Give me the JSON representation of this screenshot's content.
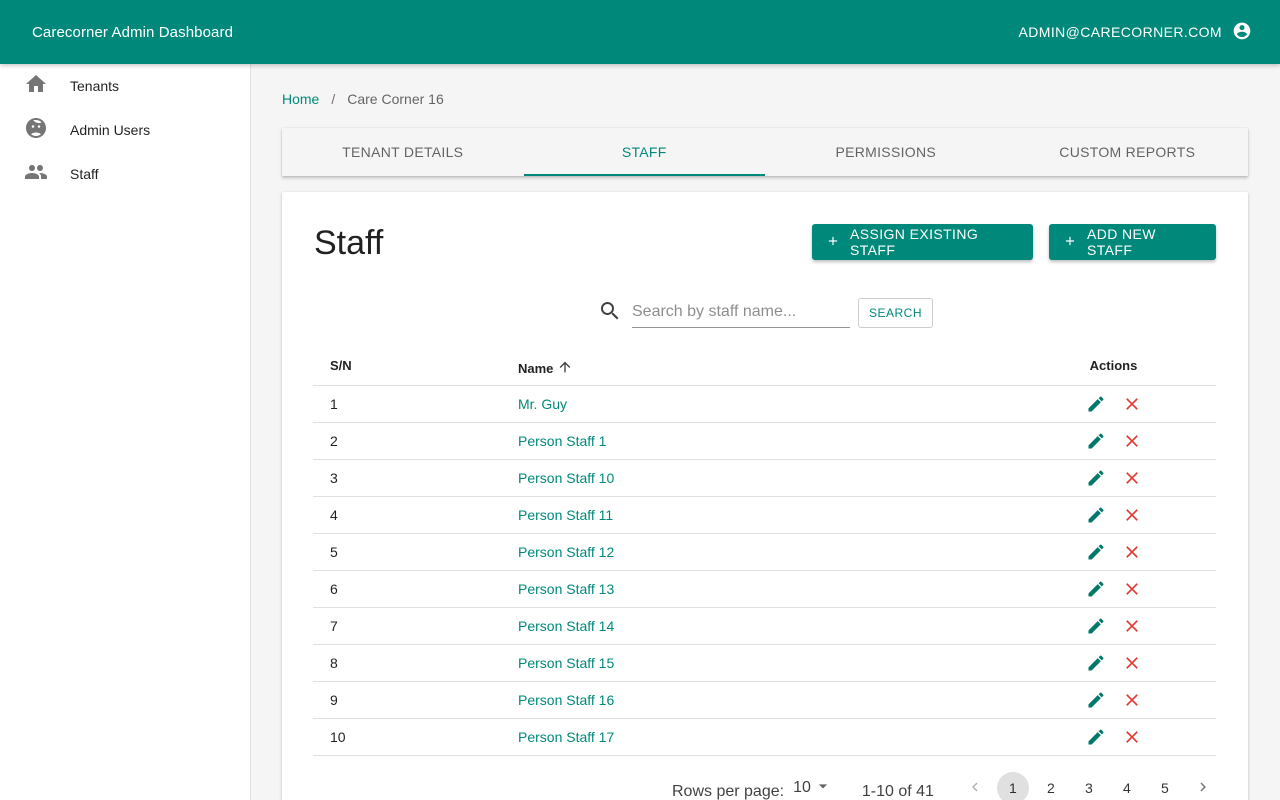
{
  "appbar": {
    "title": "Carecorner Admin Dashboard",
    "user_email": "ADMIN@CARECORNER.COM",
    "user_icon": "account-circle-icon"
  },
  "sidebar": {
    "items": [
      {
        "label": "Tenants",
        "icon": "home-icon"
      },
      {
        "label": "Admin Users",
        "icon": "face-icon"
      },
      {
        "label": "Staff",
        "icon": "people-icon"
      }
    ]
  },
  "breadcrumb": {
    "home": "Home",
    "separator": "/",
    "current": "Care Corner 16"
  },
  "tabs": [
    {
      "label": "TENANT DETAILS",
      "active": false
    },
    {
      "label": "STAFF",
      "active": true
    },
    {
      "label": "PERMISSIONS",
      "active": false
    },
    {
      "label": "CUSTOM REPORTS",
      "active": false
    }
  ],
  "staff_card": {
    "title": "Staff",
    "assign_button": "ASSIGN EXISTING STAFF",
    "add_button": "ADD NEW STAFF",
    "search_placeholder": "Search by staff name...",
    "search_value": "",
    "search_button": "SEARCH"
  },
  "table": {
    "headers": {
      "sn": "S/N",
      "name": "Name",
      "actions": "Actions"
    },
    "rows": [
      {
        "sn": "1",
        "name": "Mr. Guy"
      },
      {
        "sn": "2",
        "name": "Person Staff 1"
      },
      {
        "sn": "3",
        "name": "Person Staff 10"
      },
      {
        "sn": "4",
        "name": "Person Staff 11"
      },
      {
        "sn": "5",
        "name": "Person Staff 12"
      },
      {
        "sn": "6",
        "name": "Person Staff 13"
      },
      {
        "sn": "7",
        "name": "Person Staff 14"
      },
      {
        "sn": "8",
        "name": "Person Staff 15"
      },
      {
        "sn": "9",
        "name": "Person Staff 16"
      },
      {
        "sn": "10",
        "name": "Person Staff 17"
      }
    ]
  },
  "pagination": {
    "rows_per_page_label": "Rows per page:",
    "rows_per_page_value": "10",
    "range": "1-10 of 41",
    "pages": [
      "1",
      "2",
      "3",
      "4",
      "5"
    ],
    "current_page": "1"
  },
  "colors": {
    "primary": "#00897b",
    "delete": "#e53935"
  }
}
